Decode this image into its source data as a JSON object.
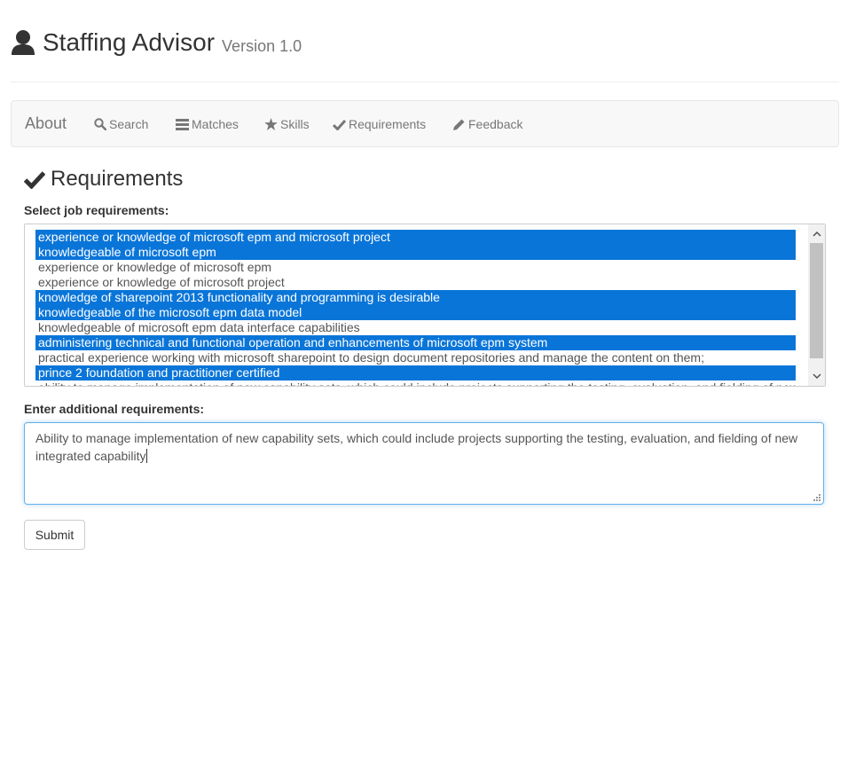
{
  "header": {
    "title": "Staffing Advisor",
    "version": "Version 1.0"
  },
  "nav": {
    "brand": "About",
    "items": [
      {
        "label": "Search",
        "icon": "search-icon"
      },
      {
        "label": "Matches",
        "icon": "list-icon"
      },
      {
        "label": "Skills",
        "icon": "star-icon"
      },
      {
        "label": "Requirements",
        "icon": "checkmark-icon"
      },
      {
        "label": "Feedback",
        "icon": "pencil-icon"
      }
    ]
  },
  "section": {
    "title": "Requirements",
    "select_label": "Select job requirements:",
    "additional_label": "Enter additional requirements:"
  },
  "requirements": {
    "options": [
      {
        "text": "experience or knowledge of microsoft epm and microsoft project",
        "selected": true
      },
      {
        "text": "knowledgeable of microsoft epm",
        "selected": true
      },
      {
        "text": "experience or knowledge of microsoft epm",
        "selected": false
      },
      {
        "text": "experience or knowledge of microsoft project",
        "selected": false
      },
      {
        "text": "knowledge of sharepoint 2013 functionality and programming is desirable",
        "selected": true
      },
      {
        "text": "knowledgeable of the microsoft epm data model",
        "selected": true
      },
      {
        "text": "knowledgeable of microsoft epm data interface capabilities",
        "selected": false
      },
      {
        "text": "administering technical and functional operation and enhancements of microsoft epm system",
        "selected": true
      },
      {
        "text": "practical experience working with microsoft sharepoint to design document repositories and manage the content on them;",
        "selected": false
      },
      {
        "text": "prince 2 foundation and practitioner certified",
        "selected": true
      },
      {
        "text": "ability to manage implementation of new capability sets, which could include projects supporting the testing, evaluation, and fielding of new",
        "selected": false
      }
    ]
  },
  "additional": {
    "value": "Ability to manage implementation of new capability sets, which could include projects supporting the testing, evaluation, and fielding of new integrated capability"
  },
  "submit_label": "Submit",
  "colors": {
    "selected_bg": "#0a75d8",
    "focus_border": "#66afe9"
  }
}
